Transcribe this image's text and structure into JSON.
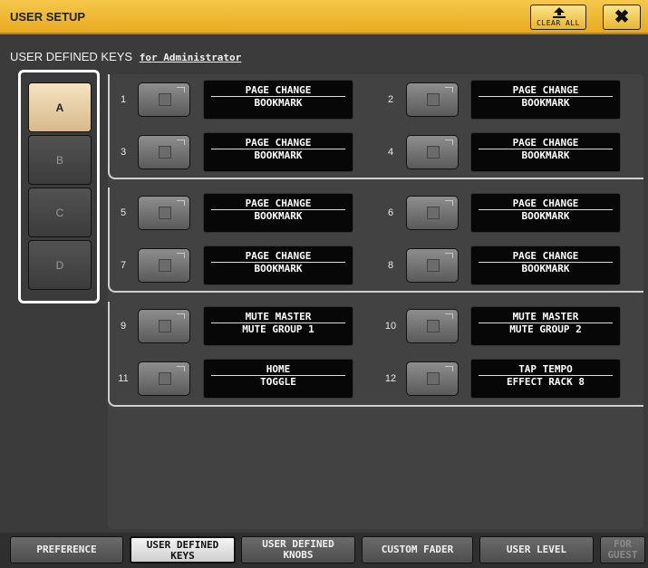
{
  "window": {
    "title": "USER SETUP",
    "clear_all_label": "CLEAR ALL",
    "close_glyph": "✖"
  },
  "section": {
    "heading": "USER DEFINED KEYS",
    "for_user": "for Administrator"
  },
  "banks": [
    {
      "label": "A",
      "selected": true
    },
    {
      "label": "B",
      "selected": false
    },
    {
      "label": "C",
      "selected": false
    },
    {
      "label": "D",
      "selected": false
    }
  ],
  "keys": [
    {
      "number": "1",
      "line1": "PAGE CHANGE",
      "line2": "BOOKMARK"
    },
    {
      "number": "2",
      "line1": "PAGE CHANGE",
      "line2": "BOOKMARK"
    },
    {
      "number": "3",
      "line1": "PAGE CHANGE",
      "line2": "BOOKMARK"
    },
    {
      "number": "4",
      "line1": "PAGE CHANGE",
      "line2": "BOOKMARK"
    },
    {
      "number": "5",
      "line1": "PAGE CHANGE",
      "line2": "BOOKMARK"
    },
    {
      "number": "6",
      "line1": "PAGE CHANGE",
      "line2": "BOOKMARK"
    },
    {
      "number": "7",
      "line1": "PAGE CHANGE",
      "line2": "BOOKMARK"
    },
    {
      "number": "8",
      "line1": "PAGE CHANGE",
      "line2": "BOOKMARK"
    },
    {
      "number": "9",
      "line1": "MUTE MASTER",
      "line2": "MUTE GROUP 1"
    },
    {
      "number": "10",
      "line1": "MUTE MASTER",
      "line2": "MUTE GROUP 2"
    },
    {
      "number": "11",
      "line1": "HOME",
      "line2": "TOGGLE"
    },
    {
      "number": "12",
      "line1": "TAP TEMPO",
      "line2": "EFFECT RACK 8"
    }
  ],
  "tabs": [
    {
      "line1": "PREFERENCE",
      "line2": "",
      "state": "normal"
    },
    {
      "line1": "USER DEFINED",
      "line2": "KEYS",
      "state": "active"
    },
    {
      "line1": "USER DEFINED",
      "line2": "KNOBS",
      "state": "normal"
    },
    {
      "line1": "CUSTOM FADER",
      "line2": "",
      "state": "normal"
    },
    {
      "line1": "USER LEVEL",
      "line2": "",
      "state": "normal"
    },
    {
      "line1": "FOR",
      "line2": "GUEST",
      "state": "disabled"
    }
  ],
  "colors": {
    "title_bar": "#e9aa20",
    "bank_selected": "#e6cca4",
    "display_bg": "#070707"
  },
  "icons": {
    "clear_all": "clear-all-arrow-icon",
    "close": "close-icon",
    "key_led": "key-led-icon"
  }
}
